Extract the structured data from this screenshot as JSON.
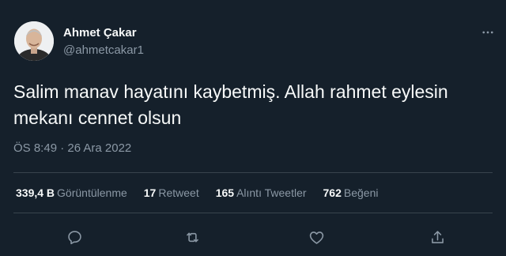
{
  "author": {
    "name": "Ahmet Çakar",
    "handle": "@ahmetcakar1",
    "avatar_icon": "profile-photo"
  },
  "tweet": {
    "text": "Salim manav hayatını kaybetmiş. Allah rahmet eylesin mekanı cennet olsun",
    "timestamp": "ÖS 8:49 · 26 Ara 2022"
  },
  "stats": [
    {
      "count": "339,4 B",
      "label": "Görüntülenme"
    },
    {
      "count": "17",
      "label": "Retweet"
    },
    {
      "count": "165",
      "label": "Alıntı Tweetler"
    },
    {
      "count": "762",
      "label": "Beğeni"
    }
  ],
  "actions": [
    {
      "icon": "reply-icon"
    },
    {
      "icon": "retweet-icon"
    },
    {
      "icon": "like-icon"
    },
    {
      "icon": "share-icon"
    }
  ],
  "colors": {
    "background": "#15202b",
    "text": "#f7f9f9",
    "muted": "#8b98a5",
    "divider": "#38444d"
  }
}
